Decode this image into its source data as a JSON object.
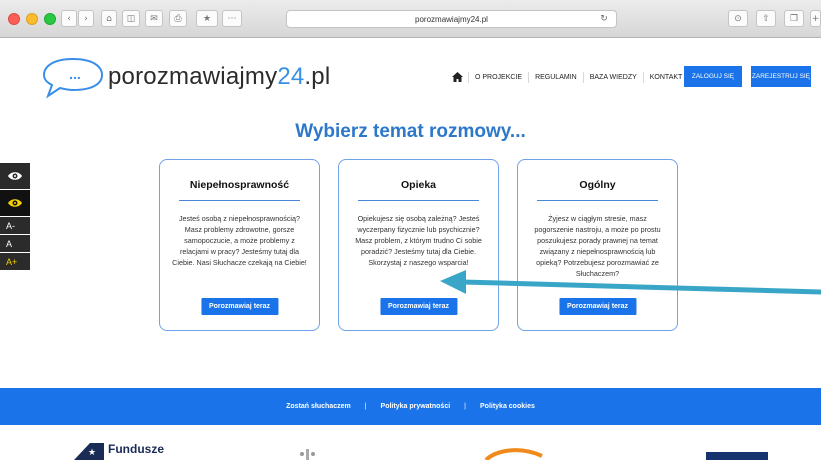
{
  "browser": {
    "address": "porozmawiajmy24.pl",
    "reload_glyph": "↻"
  },
  "header": {
    "logo_dots": "...",
    "logo_text": "porozmawiajmy",
    "logo_accent": "24",
    "logo_suffix": ".pl",
    "nav": [
      "O PROJEKCIE",
      "REGULAMIN",
      "BAZA WIEDZY",
      "KONTAKT"
    ],
    "login": "ZALOGUJ SIĘ",
    "register": "ZAREJESTRUJ SIĘ"
  },
  "hero": {
    "title": "Wybierz temat rozmowy..."
  },
  "a11y": {
    "font_small": "A-",
    "font_normal": "A",
    "font_large": "A+"
  },
  "cards": [
    {
      "title": "Niepełnosprawność",
      "description": "Jesteś osobą z niepełnosprawnością? Masz problemy zdrowotne, gorsze samopoczucie, a może problemy z relacjami w pracy? Jesteśmy tutaj dla Ciebie. Nasi Słuchacze czekają na Ciebie!",
      "cta": "Porozmawiaj teraz"
    },
    {
      "title": "Opieka",
      "description": "Opiekujesz się osobą zależną? Jesteś wyczerpany fizycznie lub psychicznie? Masz problem, z którym trudno Ci sobie poradzić? Jesteśmy tutaj dla Ciebie. Skorzystaj z naszego wsparcia!",
      "cta": "Porozmawiaj teraz"
    },
    {
      "title": "Ogólny",
      "description": "Żyjesz w ciągłym stresie, masz pogorszenie nastroju, a może po prostu poszukujesz porady prawnej na temat związany z niepełnosprawnością lub opieką? Potrzebujesz porozmawiać ze Słuchaczem?",
      "cta": "Porozmawiaj teraz"
    }
  ],
  "footer": {
    "links": [
      "Zostań słuchaczem",
      "Polityka prywatności",
      "Polityka cookies"
    ],
    "separator": "|",
    "funds_text": "Fundusze"
  },
  "colors": {
    "brand_blue": "#1a73e8",
    "title_blue": "#2d78c9",
    "arrow": "#3aa6c7"
  }
}
